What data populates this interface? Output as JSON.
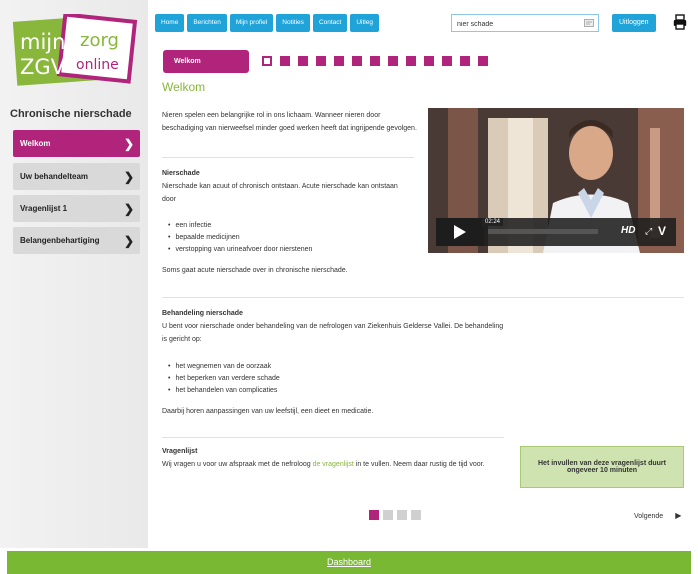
{
  "logo": {
    "line1a": "mijn",
    "line1b": "zorg",
    "line2a": "ZGV",
    "line2b": "online",
    "colors": {
      "green": "#88b73b",
      "magenta": "#b0247b"
    }
  },
  "sidebar": {
    "title": "Chronische nierschade",
    "items": [
      {
        "label": "Welkom",
        "active": true
      },
      {
        "label": "Uw behandelteam",
        "active": false
      },
      {
        "label": "Vragenlijst 1",
        "active": false
      },
      {
        "label": "Belangenbehartiging",
        "active": false
      }
    ]
  },
  "topnav": {
    "items": [
      "Home",
      "Berichten",
      "Mijn profiel",
      "Notities",
      "Contact",
      "Uitleg"
    ]
  },
  "search": {
    "value": "nier schade",
    "icon": "search-icon"
  },
  "header": {
    "logout_label": "Uitloggen",
    "print_icon": "print-icon"
  },
  "steps": {
    "current_label": "Welkom",
    "total": 14,
    "current_index": 0
  },
  "main": {
    "title": "Welkom",
    "intro": "Nieren spelen een belangrijke rol in ons lichaam. Wanneer nieren door beschadiging van nierweefsel minder goed werken heeft dat ingrijpende gevolgen.",
    "sec1": {
      "title": "Nierschade",
      "text": "Nierschade kan acuut of chronisch ontstaan. Acute nierschade kan ontstaan door",
      "bullets": [
        "een infectie",
        "bepaalde medicijnen",
        "verstopping van urineafvoer door nierstenen"
      ],
      "after": "Soms gaat acute nierschade over in chronische nierschade."
    },
    "sec2": {
      "title": "Behandeling nierschade",
      "text": "U bent voor nierschade onder behandeling van de nefrologen van Ziekenhuis Gelderse Vallei. De behandeling is gericht op:",
      "bullets": [
        "het wegnemen van de oorzaak",
        "het beperken van verdere schade",
        "het behandelen van complicaties"
      ],
      "after": "Daarbij horen aanpassingen van uw leefstijl, een dieet en medicatie."
    },
    "sec3": {
      "title": "Vragenlijst",
      "text_before": "Wij vragen u voor uw afspraak met de nefroloog ",
      "link": "de vragenlijst",
      "text_after": " in te vullen. Neem daar rustig de tijd voor."
    },
    "note": "Het invullen van deze vragenlijst duurt ongeveer 10 minuten"
  },
  "video": {
    "time": "02:24",
    "hd_label": "HD",
    "vimeo_label": "V",
    "progress": 0.0
  },
  "pager": {
    "total": 4,
    "current_index": 0,
    "next_label": "Volgende"
  },
  "footer": {
    "link_label": "Dashboard"
  }
}
